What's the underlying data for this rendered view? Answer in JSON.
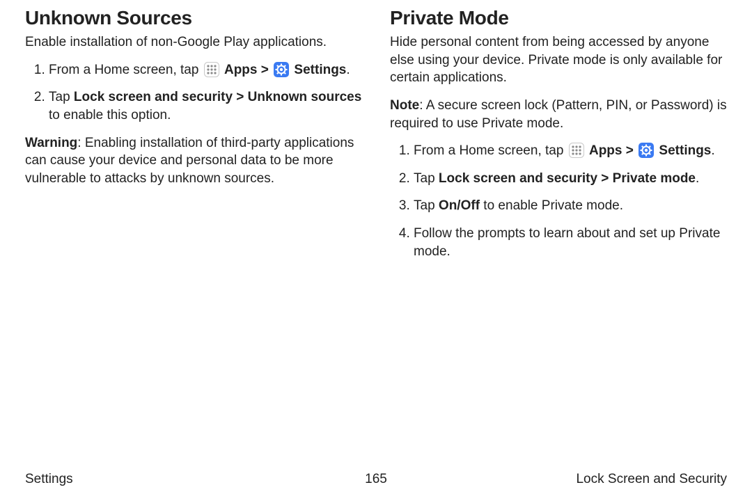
{
  "left": {
    "title": "Unknown Sources",
    "lead": "Enable installation of non-Google Play applications.",
    "step1_prefix": "From a Home screen, tap ",
    "apps_label": "Apps",
    "settings_label": "Settings",
    "step1_suffix": ".",
    "step2_prefix": "Tap ",
    "step2_bold": "Lock screen and security > Unknown sources",
    "step2_suffix": " to enable this option.",
    "warning_label": "Warning",
    "warning_text": ": Enabling installation of third-party applications can cause your device and personal data to be more vulnerable to attacks by unknown sources."
  },
  "right": {
    "title": "Private Mode",
    "lead": "Hide personal content from being accessed by anyone else using your device. Private mode is only available for certain applications.",
    "note_label": "Note",
    "note_text": ": A secure screen lock (Pattern, PIN, or Password) is required to use Private mode.",
    "step1_prefix": "From a Home screen, tap ",
    "apps_label": "Apps",
    "settings_label": "Settings",
    "step1_suffix": ".",
    "step2_prefix": "Tap ",
    "step2_bold": "Lock screen and security > Private mode",
    "step2_suffix": ".",
    "step3_prefix": "Tap ",
    "step3_bold": "On/Off",
    "step3_suffix": " to enable Private mode.",
    "step4": "Follow the prompts to learn about and set up Private mode."
  },
  "footer": {
    "left": "Settings",
    "center": "165",
    "right": "Lock Screen and Security"
  },
  "glyphs": {
    "chevron": " > "
  }
}
